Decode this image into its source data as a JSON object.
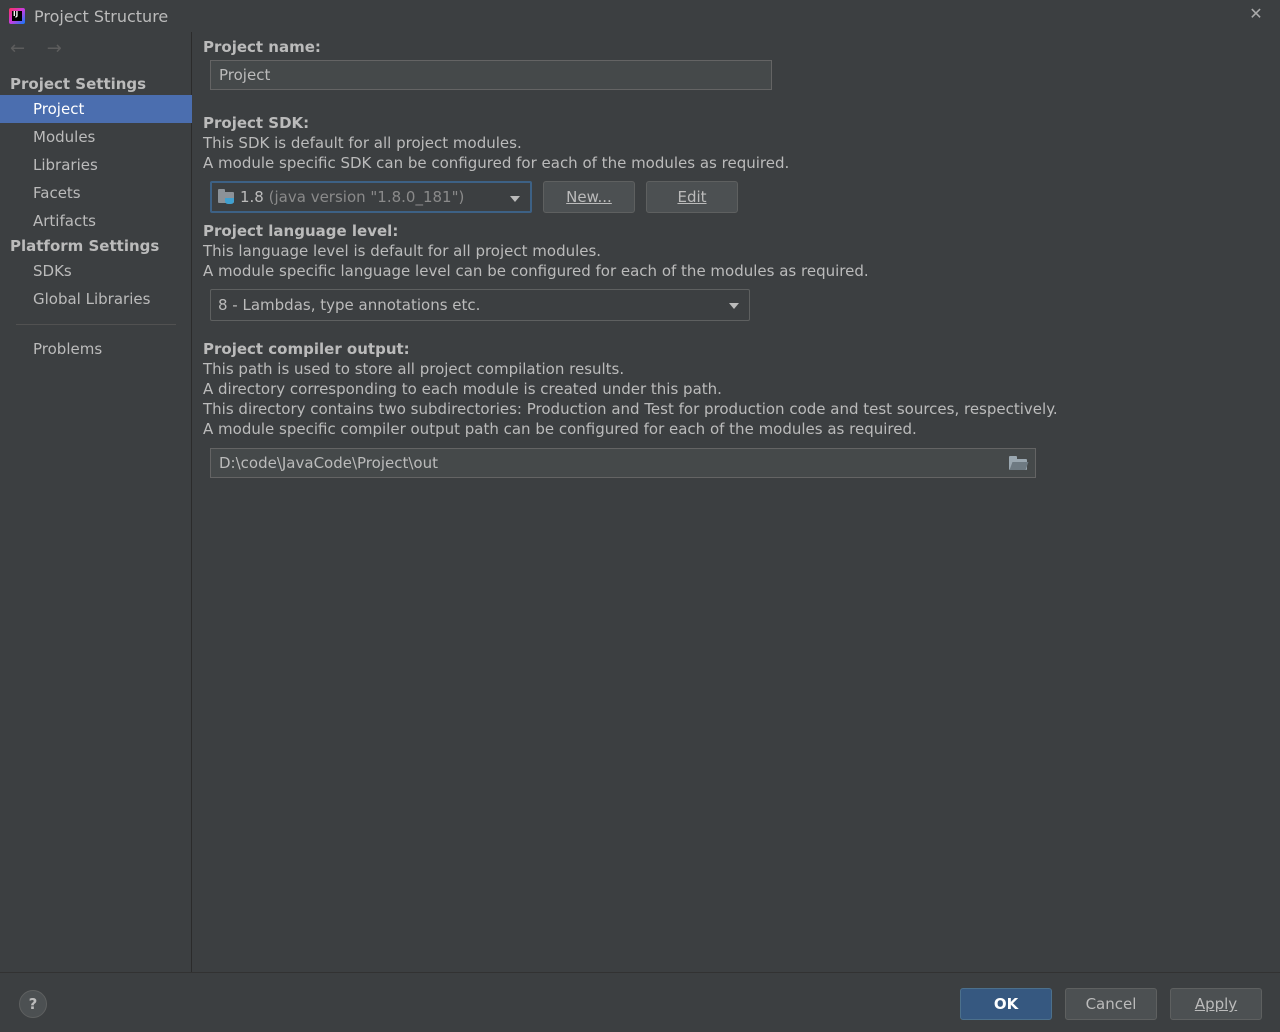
{
  "window": {
    "title": "Project Structure",
    "app_icon_text": "IJ"
  },
  "nav": {
    "back_glyph": "←",
    "forward_glyph": "→"
  },
  "sidebar": {
    "project_settings_heading": "Project Settings",
    "platform_settings_heading": "Platform Settings",
    "items": {
      "project": "Project",
      "modules": "Modules",
      "libraries": "Libraries",
      "facets": "Facets",
      "artifacts": "Artifacts",
      "sdks": "SDKs",
      "global_libraries": "Global Libraries",
      "problems": "Problems"
    },
    "selected": "Project"
  },
  "main": {
    "project_name": {
      "label": "Project name:",
      "value": "Project"
    },
    "sdk": {
      "label": "Project SDK:",
      "desc1": "This SDK is default for all project modules.",
      "desc2": "A module specific SDK can be configured for each of the modules as required.",
      "selected_version": "1.8",
      "selected_detail": "(java version \"1.8.0_181\")",
      "new_button": "New...",
      "edit_button": "Edit"
    },
    "language_level": {
      "label": "Project language level:",
      "desc1": "This language level is default for all project modules.",
      "desc2": "A module specific language level can be configured for each of the modules as required.",
      "selected": "8 - Lambdas, type annotations etc."
    },
    "compiler_output": {
      "label": "Project compiler output:",
      "desc1": "This path is used to store all project compilation results.",
      "desc2": "A directory corresponding to each module is created under this path.",
      "desc3": "This directory contains two subdirectories: Production and Test for production code and test sources, respectively.",
      "desc4": "A module specific compiler output path can be configured for each of the modules as required.",
      "path": "D:\\code\\JavaCode\\Project\\out"
    }
  },
  "footer": {
    "help": "?",
    "ok": "OK",
    "cancel": "Cancel",
    "apply": "Apply"
  },
  "icons": {
    "app": "intellij-icon",
    "close": "close-icon",
    "back": "back-arrow-icon",
    "forward": "forward-arrow-icon",
    "sdk": "jdk-folder-icon",
    "browse": "folder-icon",
    "dropdown": "chevron-down-icon",
    "help": "help-icon"
  },
  "colors": {
    "background": "#3c3f41",
    "selection": "#4b6eaf",
    "primary_button": "#365880"
  }
}
